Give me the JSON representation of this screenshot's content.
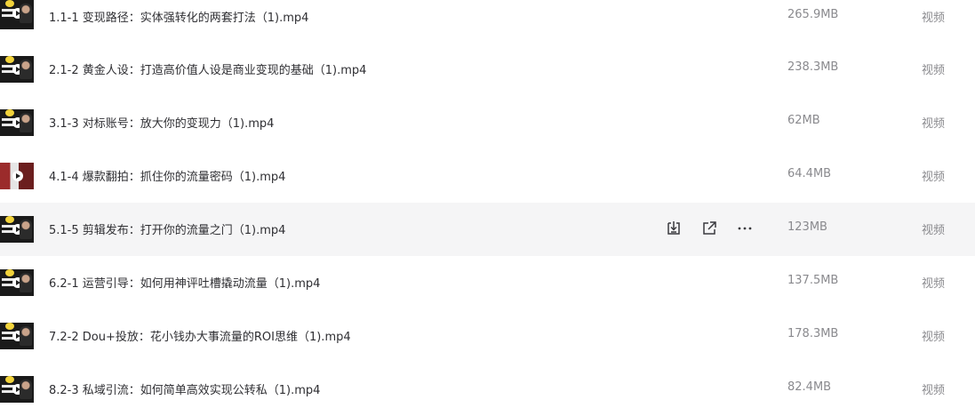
{
  "files": [
    {
      "name": "1.1-1 变现路径：实体强转化的两套打法（1).mp4",
      "size": "265.9MB",
      "type": "视频",
      "thumb": "yellow"
    },
    {
      "name": "2.1-2 黄金人设：打造高价值人设是商业变现的基础（1).mp4",
      "size": "238.3MB",
      "type": "视频",
      "thumb": "yellow"
    },
    {
      "name": "3.1-3 对标账号：放大你的变现力（1).mp4",
      "size": "62MB",
      "type": "视频",
      "thumb": "yellow"
    },
    {
      "name": "4.1-4 爆款翻拍：抓住你的流量密码（1).mp4",
      "size": "64.4MB",
      "type": "视频",
      "thumb": "red"
    },
    {
      "name": "5.1-5 剪辑发布：打开你的流量之门（1).mp4",
      "size": "123MB",
      "type": "视频",
      "thumb": "yellow",
      "hovered": true
    },
    {
      "name": "6.2-1 运营引导：如何用神评吐槽撬动流量（1).mp4",
      "size": "137.5MB",
      "type": "视频",
      "thumb": "yellow"
    },
    {
      "name": "7.2-2 Dou+投放：花小钱办大事流量的ROI思维（1).mp4",
      "size": "178.3MB",
      "type": "视频",
      "thumb": "yellow"
    },
    {
      "name": "8.2-3 私域引流：如何简单高效实现公转私（1).mp4",
      "size": "82.4MB",
      "type": "视频",
      "thumb": "yellow"
    }
  ],
  "row_actions": {
    "download_icon": "download-icon",
    "share_icon": "share-icon",
    "more_icon": "more-icon"
  }
}
